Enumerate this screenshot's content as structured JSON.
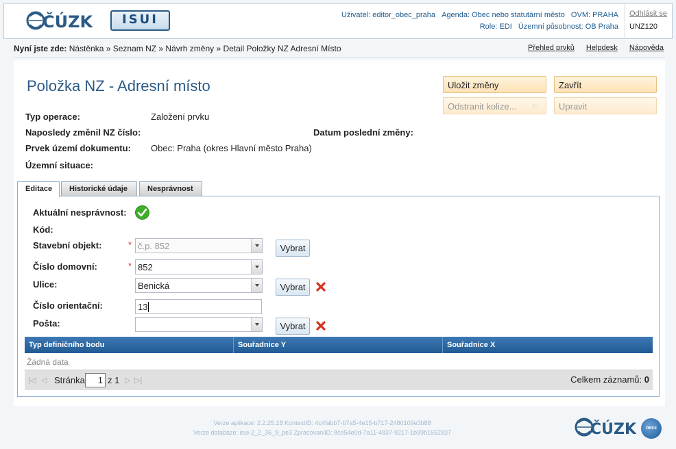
{
  "header": {
    "logo_text": "ČÚZK",
    "isui_logo": "ISUI",
    "user_label": "Uživatel: editor_obec_praha",
    "agenda_label": "Agenda: Obec nebo statutární město",
    "ovm_label": "OVM: PRAHA",
    "role_label": "Role: EDI",
    "scope_label": "Územní působnost: OB Praha",
    "logout": "Odhlásit se",
    "user_id": "UNZ120"
  },
  "breadcrumb": {
    "prefix": "Nyní jste zde:",
    "path": "Nástěnka » Seznam NZ » Návrh změny » Detail Položky NZ Adresní Místo",
    "links": [
      "Přehled prvků",
      "Helpdesk",
      "Nápověda"
    ]
  },
  "page": {
    "title": "Položka NZ - Adresní místo"
  },
  "actions": {
    "save": "Uložit změny",
    "close": "Zavřít",
    "resolve_conflicts": "Odstranit kolize...",
    "edit": "Upravit"
  },
  "details": {
    "operation_type_label": "Typ operace:",
    "operation_type_value": "Založení prvku",
    "last_changed_label": "Naposledy změnil NZ číslo:",
    "last_changed_value": "",
    "last_change_date_label": "Datum poslední změny:",
    "last_change_date_value": "",
    "territorial_element_label": "Prvek území dokumentu:",
    "territorial_element_value": "Obec: Praha (okres Hlavní město Praha)",
    "territorial_situation_label": "Územní situace:",
    "territorial_situation_value": ""
  },
  "tabs": [
    "Editace",
    "Historické údaje",
    "Nesprávnost"
  ],
  "form": {
    "incorrectness_label": "Aktuální nesprávnost:",
    "code_label": "Kód:",
    "building_label": "Stavební objekt:",
    "building_value": "č.p. 852",
    "house_number_label": "Číslo domovní:",
    "house_number_value": "852",
    "street_label": "Ulice:",
    "street_value": "Benická",
    "orientation_number_label": "Číslo orientační:",
    "orientation_number_value": "13",
    "post_label": "Pošta:",
    "post_value": "",
    "select_button": "Vybrat",
    "required_mark": "*"
  },
  "grid": {
    "columns": [
      "Typ definičního bodu",
      "Souřadnice Y",
      "Souřadnice X"
    ],
    "empty_text": "Žádná data",
    "page_label": "Stránka",
    "page_value": "1",
    "page_of": "z 1",
    "total_label": "Celkem záznamů:",
    "total_value": "0"
  },
  "footer": {
    "line1": "Verze aplikace: 2.2.25.18 KontextID: 4c4fabb7-b7a5-4e15-b717-2480109e3b88",
    "line2": "Verze databáze: isui-2_2_36_9_pe3 ZpracovaniID: 8ce54e0d-7a11-4837-9217-1b99b1552837",
    "ness_logo": "ness"
  },
  "colors": {
    "accent": "#2c5a86",
    "action_button": "#fde3b6",
    "grid_header": "#2b66a0",
    "ok_green": "#3fae2a",
    "delete_red": "#d9301c"
  }
}
